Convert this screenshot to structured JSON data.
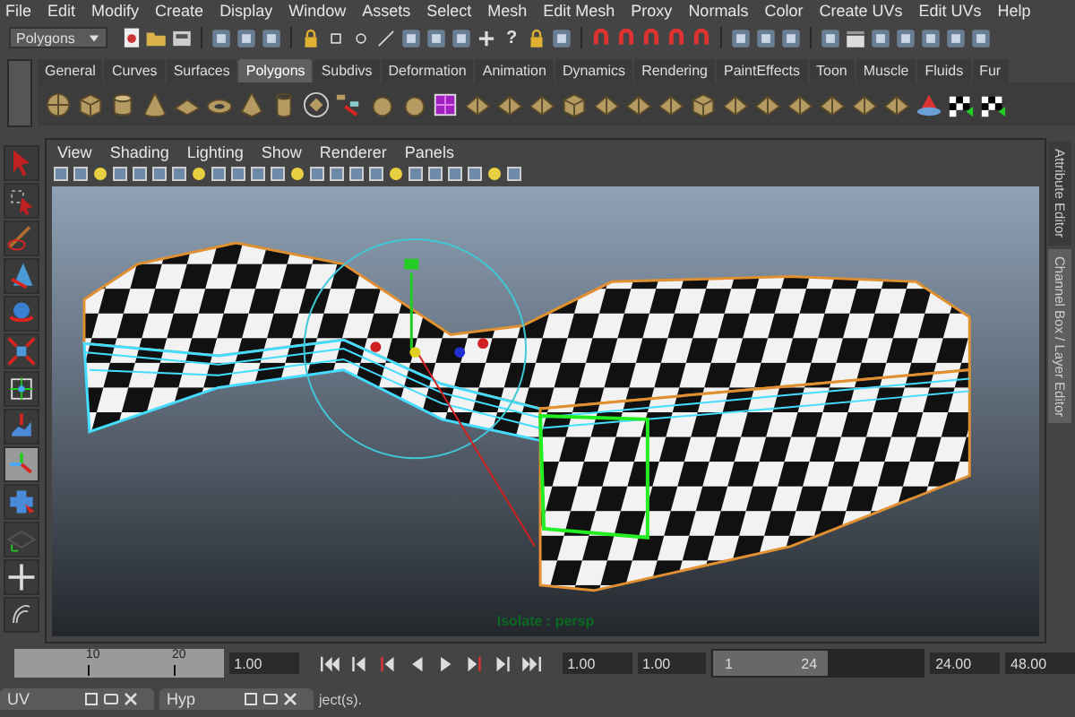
{
  "menu_bar": [
    "File",
    "Edit",
    "Modify",
    "Create",
    "Display",
    "Window",
    "Assets",
    "Select",
    "Mesh",
    "Edit Mesh",
    "Proxy",
    "Normals",
    "Color",
    "Create UVs",
    "Edit UVs",
    "Help"
  ],
  "status_line": {
    "mode": "Polygons",
    "help": "?"
  },
  "shelf_tabs": [
    {
      "label": "General",
      "selected": false
    },
    {
      "label": "Curves",
      "selected": false
    },
    {
      "label": "Surfaces",
      "selected": false
    },
    {
      "label": "Polygons",
      "selected": true
    },
    {
      "label": "Subdivs",
      "selected": false
    },
    {
      "label": "Deformation",
      "selected": false
    },
    {
      "label": "Animation",
      "selected": false
    },
    {
      "label": "Dynamics",
      "selected": false
    },
    {
      "label": "Rendering",
      "selected": false
    },
    {
      "label": "PaintEffects",
      "selected": false
    },
    {
      "label": "Toon",
      "selected": false
    },
    {
      "label": "Muscle",
      "selected": false
    },
    {
      "label": "Fluids",
      "selected": false
    },
    {
      "label": "Fur",
      "selected": false
    }
  ],
  "tool_box": [
    {
      "selected": false
    },
    {
      "selected": false
    },
    {
      "selected": false
    },
    {
      "selected": false
    },
    {
      "selected": false
    },
    {
      "selected": false
    },
    {
      "selected": false
    },
    {
      "selected": false
    },
    {
      "selected": true
    },
    {
      "selected": false
    },
    {
      "selected": false
    },
    {
      "selected": false
    },
    {
      "selected": false
    }
  ],
  "panel_menu": [
    "View",
    "Shading",
    "Lighting",
    "Show",
    "Renderer",
    "Panels"
  ],
  "viewport": {
    "hud": "Isolate : persp"
  },
  "side_tabs": [
    {
      "label": "Attribute Editor",
      "selected": false
    },
    {
      "label": "Channel Box / Layer Editor",
      "selected": true
    }
  ],
  "time_slider": {
    "ticks": [
      "10",
      "20"
    ],
    "current_time": "1.00",
    "start_time": "1.00",
    "playback_start": "1.00",
    "range_slider": {
      "start": "1",
      "end": "24",
      "level": 0.53
    },
    "playback_end": "24.00",
    "end_time": "48.00"
  },
  "taskbar": [
    {
      "title": "UV"
    },
    {
      "title": "Hyp"
    }
  ],
  "help_line": "ject(s)."
}
